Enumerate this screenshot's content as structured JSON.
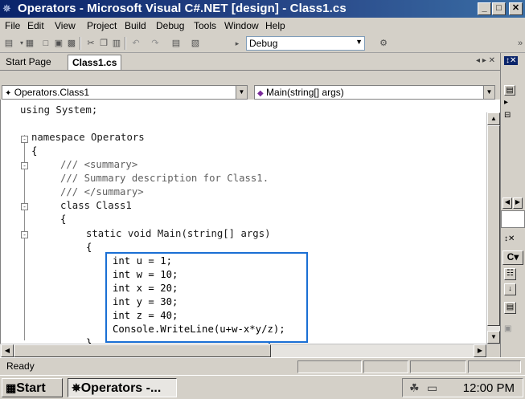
{
  "window": {
    "title": "Operators - Microsoft Visual C#.NET [design] - Class1.cs",
    "controls": {
      "minimize": "_",
      "maximize": "□",
      "close": "✕"
    }
  },
  "menu": [
    "File",
    "Edit",
    "View",
    "Project",
    "Build",
    "Debug",
    "Tools",
    "Window",
    "Help"
  ],
  "toolbar": {
    "configuration": "Debug"
  },
  "tabs": {
    "start_page": "Start Page",
    "active": "Class1.cs",
    "nav_arrows": "◂ ▸ ✕"
  },
  "navbar": {
    "class_combo": "Operators.Class1",
    "member_combo": "Main(string[] args)"
  },
  "code": {
    "l1": "using System;",
    "l2": "namespace Operators",
    "l3": "{",
    "l4": "/// <summary>",
    "l5": "/// Summary description for Class1.",
    "l6": "/// </summary>",
    "l7": "class Class1",
    "l8": "{",
    "l9": "static void Main(string[] args)",
    "l10": "{",
    "l11": "int u = 1;",
    "l12": "int w = 10;",
    "l13": "int x = 20;",
    "l14": "int y = 30;",
    "l15": "int z = 40;",
    "l16": "Console.WriteLine(u+w-x*y/z);",
    "l17": "}"
  },
  "status": {
    "text": "Ready"
  },
  "taskbar": {
    "start": "Start",
    "task": "Operators -...",
    "clock": "12:00 PM"
  },
  "colors": {
    "titlebar": "#0a246a",
    "callout": "#1a6fd4",
    "chrome": "#d4d0c8"
  },
  "icons": [
    "app-icon",
    "new-project-icon",
    "open-icon",
    "save-icon",
    "cut-icon",
    "copy-icon",
    "paste-icon",
    "undo-icon",
    "redo-icon",
    "class-icon",
    "method-icon",
    "collapse-icon",
    "expand-icon",
    "windows-logo-icon",
    "vs-icon",
    "network-icon",
    "monitor-icon"
  ]
}
